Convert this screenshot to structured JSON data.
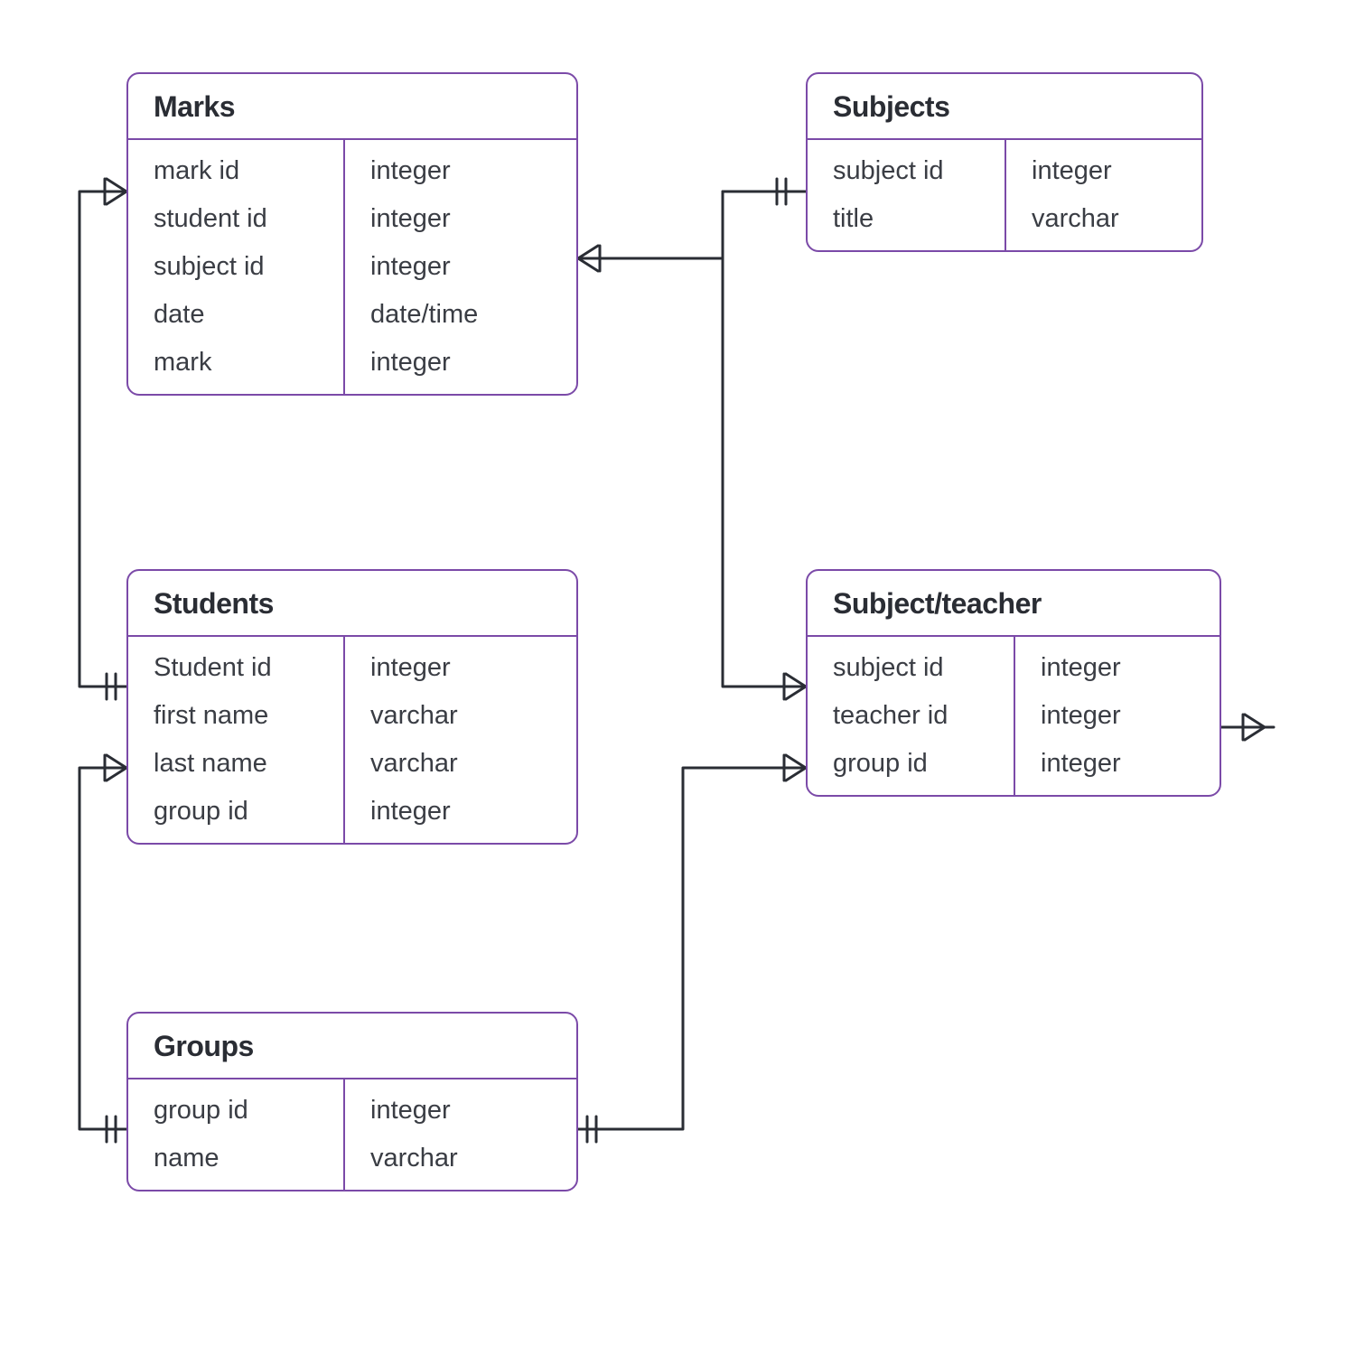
{
  "entities": {
    "marks": {
      "title": "Marks",
      "fields": [
        {
          "name": "mark id",
          "type": "integer"
        },
        {
          "name": "student id",
          "type": "integer"
        },
        {
          "name": "subject id",
          "type": "integer"
        },
        {
          "name": "date",
          "type": "date/time"
        },
        {
          "name": "mark",
          "type": "integer"
        }
      ]
    },
    "subjects": {
      "title": "Subjects",
      "fields": [
        {
          "name": "subject id",
          "type": "integer"
        },
        {
          "name": "title",
          "type": "varchar"
        }
      ]
    },
    "students": {
      "title": "Students",
      "fields": [
        {
          "name": "Student id",
          "type": "integer"
        },
        {
          "name": "first name",
          "type": "varchar"
        },
        {
          "name": "last name",
          "type": "varchar"
        },
        {
          "name": "group id",
          "type": "integer"
        }
      ]
    },
    "subject_teacher": {
      "title": "Subject/teacher",
      "fields": [
        {
          "name": "subject id",
          "type": "integer"
        },
        {
          "name": "teacher id",
          "type": "integer"
        },
        {
          "name": "group id",
          "type": "integer"
        }
      ]
    },
    "groups": {
      "title": "Groups",
      "fields": [
        {
          "name": "group id",
          "type": "integer"
        },
        {
          "name": "name",
          "type": "varchar"
        }
      ]
    }
  },
  "relationships": [
    {
      "from": "students",
      "to": "marks",
      "from_card": "one",
      "to_card": "many"
    },
    {
      "from": "subjects",
      "to": "marks",
      "from_card": "one",
      "to_card": "many"
    },
    {
      "from": "subjects",
      "to": "subject_teacher",
      "from_card": "one",
      "to_card": "many"
    },
    {
      "from": "groups",
      "to": "students",
      "from_card": "one",
      "to_card": "many"
    },
    {
      "from": "groups",
      "to": "subject_teacher",
      "from_card": "one",
      "to_card": "many"
    },
    {
      "from": "teachers_offscreen",
      "to": "subject_teacher",
      "from_card": "one",
      "to_card": "many"
    }
  ],
  "colors": {
    "border": "#7b4aa8",
    "text": "#2a2d34",
    "connector": "#2a2d34"
  }
}
